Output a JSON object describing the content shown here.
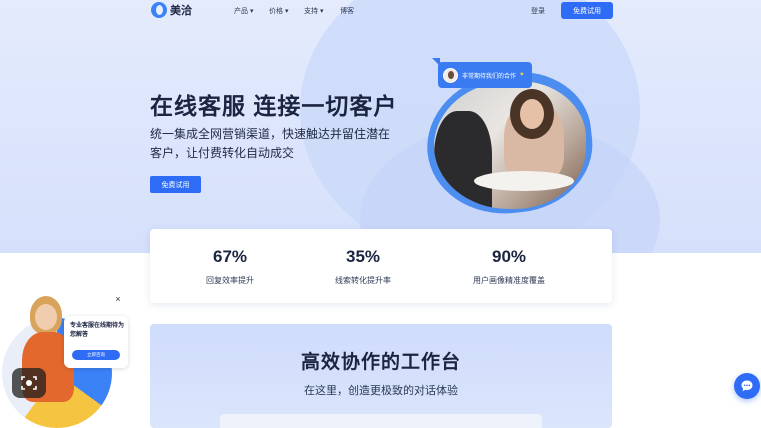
{
  "nav": {
    "brand": "美洽",
    "menu": [
      "产品",
      "价格",
      "支持",
      "博客"
    ],
    "login": "登录",
    "trial": "免费试用"
  },
  "hero": {
    "title": "在线客服 连接一切客户",
    "subtitle": "统一集成全网营销渠道，快速触达并留住潜在客户，让付费转化自动成交",
    "cta": "免费试用",
    "chat_tag": "非常期待我们的合作"
  },
  "stats": [
    {
      "value": "67%",
      "label": "回复效率提升"
    },
    {
      "value": "35%",
      "label": "线索转化提升率"
    },
    {
      "value": "90%",
      "label": "用户画像精准度覆盖"
    }
  ],
  "workbench": {
    "title": "高效协作的工作台",
    "subtitle": "在这里，创造更极致的对话体验"
  },
  "widget": {
    "text": "专业客服在线期待为您解答",
    "button": "立即咨询",
    "close": "×"
  },
  "colors": {
    "primary": "#2f6cf6",
    "hero_bg": "#dde6fc",
    "text_dark": "#1b2440"
  }
}
